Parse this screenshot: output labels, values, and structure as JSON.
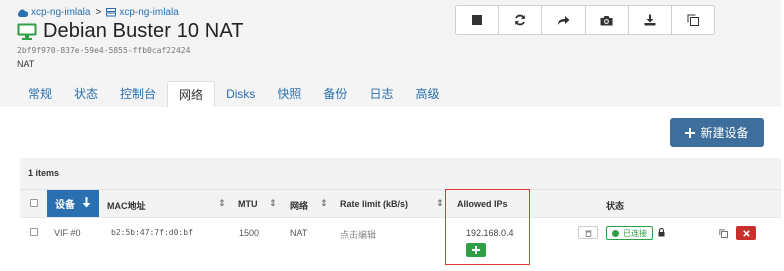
{
  "breadcrumb": {
    "pool": "xcp-ng-imlala",
    "host": "xcp-ng-imlala"
  },
  "vm": {
    "title": "Debian Buster 10 NAT",
    "uuid": "2bf9f970-837e-59e4-5855-ffb0caf22424",
    "description": "NAT"
  },
  "toolbar": {
    "icons": [
      "stop-icon",
      "restart-icon",
      "migrate-icon",
      "snapshot-icon",
      "export-icon",
      "copy-icon"
    ]
  },
  "tabs": [
    "常规",
    "状态",
    "控制台",
    "网络",
    "Disks",
    "快照",
    "备份",
    "日志",
    "高级"
  ],
  "active_tab": "网络",
  "new_device_button": "新建设备",
  "items_label": "1 items",
  "table": {
    "headers": {
      "device": "设备",
      "mac": "MAC地址",
      "mtu": "MTU",
      "network": "网络",
      "rate_limit": "Rate limit (kB/s)",
      "allowed_ips": "Allowed IPs",
      "status": "状态"
    },
    "rows": [
      {
        "device": "VIF #0",
        "mac": "b2:5b:47:7f:d0:bf",
        "mtu": "1500",
        "network": "NAT",
        "rate_limit": "点击编辑",
        "allowed_ip": "192.168.0.4",
        "status": "已连接"
      }
    ]
  },
  "colors": {
    "accent": "#2a6fb0",
    "primary_button": "#3d6e9c",
    "success": "#2f9e44",
    "danger": "#c9302c",
    "highlight_border": "#e23b3b"
  }
}
